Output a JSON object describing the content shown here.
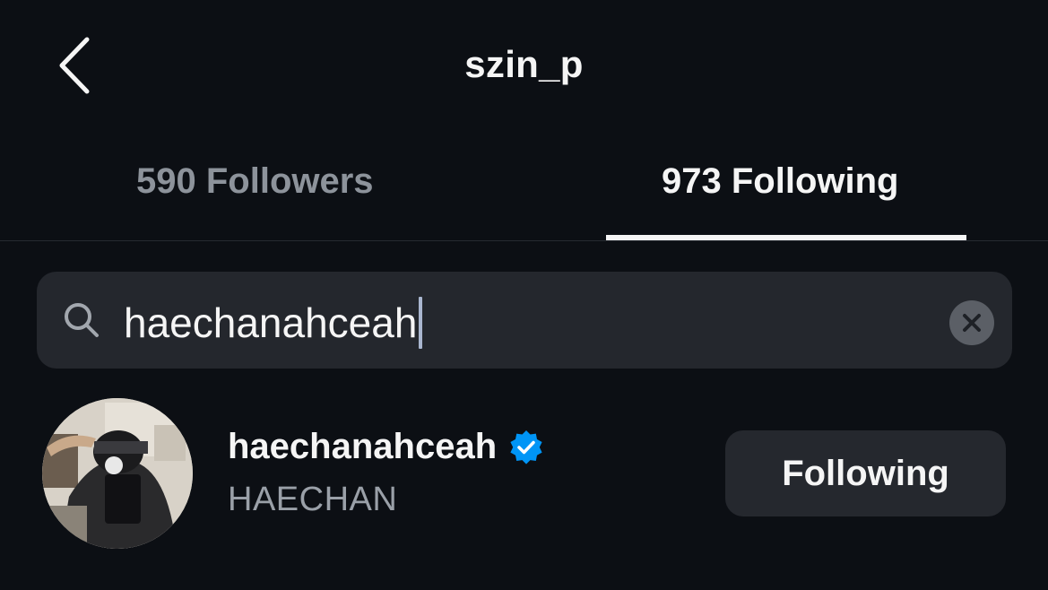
{
  "header": {
    "title": "szin_p",
    "back_icon": "chevron-left-icon"
  },
  "tabs": [
    {
      "label": "590 Followers",
      "active": false
    },
    {
      "label": "973 Following",
      "active": true
    }
  ],
  "search": {
    "value": "haechanahceah",
    "search_icon": "search-icon",
    "clear_icon": "clear-icon"
  },
  "results": [
    {
      "username": "haechanahceah",
      "verified": true,
      "full_name": "HAECHAN",
      "button_label": "Following"
    }
  ],
  "colors": {
    "background": "#0c0f14",
    "search_bg": "#24272d",
    "button_bg": "#25282e",
    "inactive_tab": "#8d939b",
    "verified_blue": "#0095f6"
  }
}
